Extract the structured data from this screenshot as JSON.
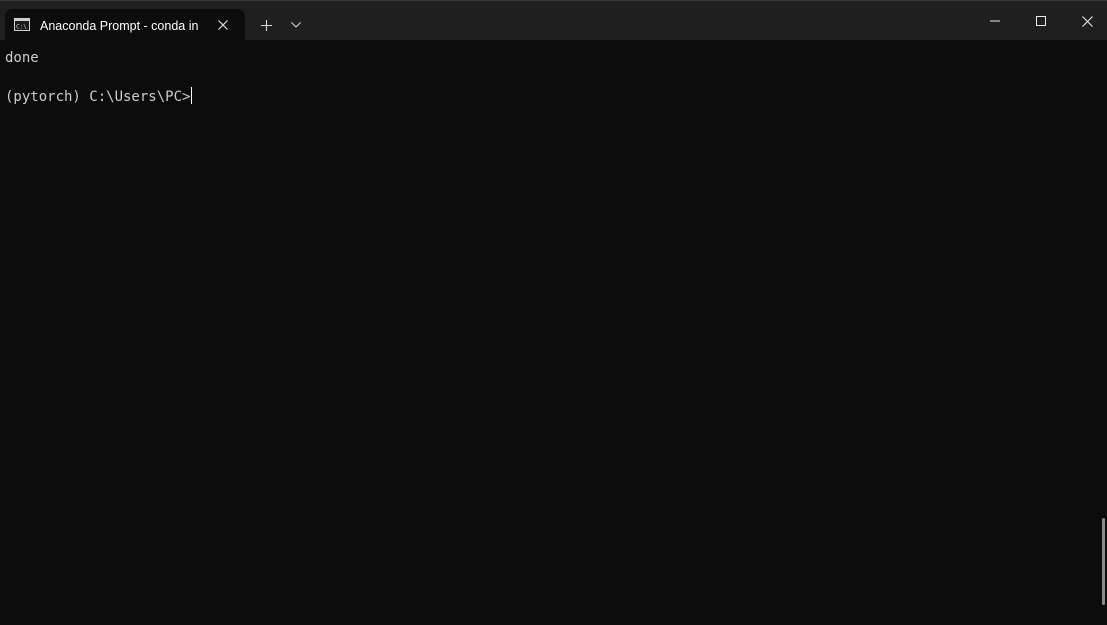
{
  "window": {
    "tab": {
      "title": "Anaconda Prompt - conda  in",
      "icon": "cmd-icon"
    },
    "controls": {
      "new_tab_icon": "plus-icon",
      "dropdown_icon": "chevron-down-icon",
      "minimize_icon": "minimize-icon",
      "maximize_icon": "maximize-icon",
      "close_icon": "close-icon"
    }
  },
  "terminal": {
    "lines": [
      "done",
      "(pytorch) C:\\Users\\PC>"
    ],
    "text_color": "#cccccc",
    "background_color": "#0c0c0c"
  },
  "scrollbar": {
    "position_fraction": 0.86
  }
}
